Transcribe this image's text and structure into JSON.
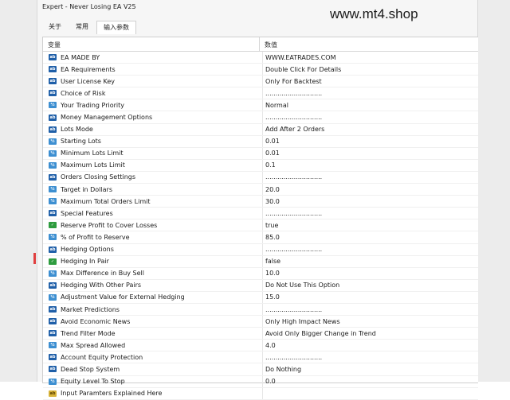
{
  "window": {
    "title": "Expert - Never Losing EA V25"
  },
  "watermark": "www.mt4.shop",
  "tabs": [
    {
      "label": "关于",
      "active": false
    },
    {
      "label": "常用",
      "active": false
    },
    {
      "label": "输入参数",
      "active": true
    }
  ],
  "table": {
    "headers": {
      "variable": "变量",
      "value": "数值"
    },
    "rows": [
      {
        "icon": "ab",
        "name": "EA MADE BY",
        "value": "WWW.EATRADES.COM"
      },
      {
        "icon": "ab",
        "name": "EA Requirements",
        "value": "Double Click For Details"
      },
      {
        "icon": "ab",
        "name": "User License Key",
        "value": "Only For Backtest"
      },
      {
        "icon": "ab",
        "name": "Choice of Risk",
        "value": "............................"
      },
      {
        "icon": "num",
        "name": "Your Trading Priority",
        "value": "Normal"
      },
      {
        "icon": "ab",
        "name": "Money Management Options",
        "value": "............................"
      },
      {
        "icon": "ab",
        "name": "Lots Mode",
        "value": "Add After 2 Orders"
      },
      {
        "icon": "num",
        "name": "Starting Lots",
        "value": "0.01"
      },
      {
        "icon": "num",
        "name": "Minimum Lots Limit",
        "value": "0.01"
      },
      {
        "icon": "num",
        "name": "Maximum Lots Limit",
        "value": "0.1"
      },
      {
        "icon": "ab",
        "name": "Orders Closing Settings",
        "value": "............................"
      },
      {
        "icon": "num",
        "name": "Target in Dollars",
        "value": "20.0"
      },
      {
        "icon": "num",
        "name": "Maximum Total Orders Limit",
        "value": "30.0"
      },
      {
        "icon": "ab",
        "name": "Special Features",
        "value": "............................"
      },
      {
        "icon": "chk",
        "name": "Reserve Profit to Cover Losses",
        "value": "true"
      },
      {
        "icon": "num",
        "name": "% of Profit to Reserve",
        "value": "85.0"
      },
      {
        "icon": "ab",
        "name": "Hedging Options",
        "value": "............................"
      },
      {
        "icon": "chk",
        "name": "Hedging In Pair",
        "value": "false"
      },
      {
        "icon": "num",
        "name": "Max Difference in Buy Sell",
        "value": "10.0"
      },
      {
        "icon": "ab",
        "name": "Hedging With Other Pairs",
        "value": "Do Not Use This Option"
      },
      {
        "icon": "num",
        "name": "Adjustment Value for External Hedging",
        "value": "15.0"
      },
      {
        "icon": "ab",
        "name": "Market Predictions",
        "value": "............................"
      },
      {
        "icon": "ab",
        "name": "Avoid Economic News",
        "value": "Only High Impact News"
      },
      {
        "icon": "ab",
        "name": "Trend Filter Mode",
        "value": "Avoid Only Bigger Change in Trend"
      },
      {
        "icon": "num",
        "name": "Max Spread Allowed",
        "value": "4.0"
      },
      {
        "icon": "ab",
        "name": "Account Equity Protection",
        "value": "............................"
      },
      {
        "icon": "ab",
        "name": "Dead Stop System",
        "value": "Do Nothing"
      },
      {
        "icon": "num",
        "name": "Equity Level To Stop",
        "value": "0.0"
      },
      {
        "icon": "note",
        "name": "Input Paramters Explained Here",
        "value": ""
      }
    ]
  }
}
